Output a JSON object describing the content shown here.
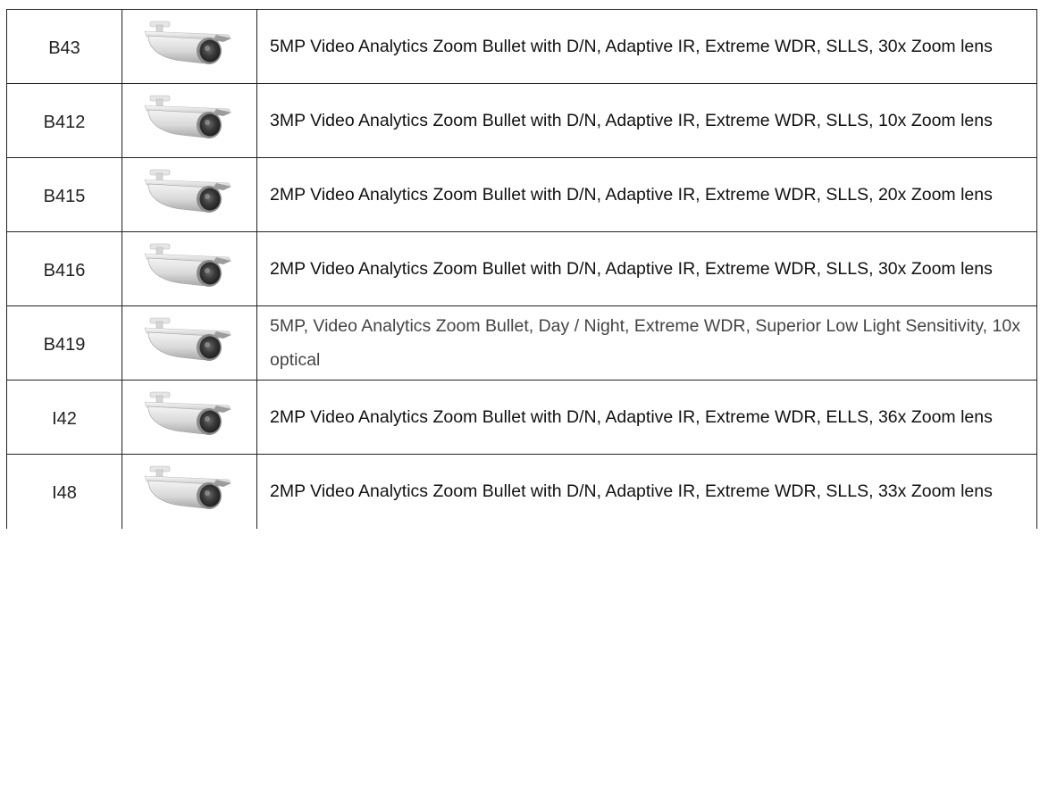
{
  "products": [
    {
      "model": "B43",
      "image_icon": "bullet-camera-icon",
      "description": "5MP Video Analytics Zoom Bullet with D/N, Adaptive IR, Extreme WDR, SLLS, 30x Zoom lens"
    },
    {
      "model": "B412",
      "image_icon": "bullet-camera-icon",
      "description": "3MP Video Analytics Zoom Bullet with D/N, Adaptive IR, Extreme WDR, SLLS, 10x Zoom lens"
    },
    {
      "model": "B415",
      "image_icon": "bullet-camera-icon",
      "description": "2MP Video Analytics Zoom Bullet with D/N, Adaptive IR, Extreme WDR, SLLS, 20x Zoom lens"
    },
    {
      "model": "B416",
      "image_icon": "bullet-camera-icon",
      "description": "2MP Video Analytics Zoom Bullet with D/N, Adaptive IR, Extreme WDR, SLLS, 30x Zoom lens"
    },
    {
      "model": "B419",
      "image_icon": "bullet-camera-icon",
      "description": "5MP, Video Analytics Zoom Bullet, Day / Night, Extreme WDR, Superior Low Light Sensitivity, 10x optical"
    },
    {
      "model": "I42",
      "image_icon": "bullet-camera-icon",
      "description": "2MP Video Analytics Zoom Bullet with D/N, Adaptive IR, Extreme WDR, ELLS, 36x Zoom lens"
    },
    {
      "model": "I48",
      "image_icon": "bullet-camera-icon",
      "description": "2MP Video Analytics Zoom Bullet with D/N, Adaptive IR, Extreme WDR, SLLS, 33x Zoom lens"
    }
  ],
  "colors": {
    "border": "#222222",
    "text": "#111111",
    "camera_body": "#dcdcdc",
    "camera_lens": "#3a3a3a"
  }
}
